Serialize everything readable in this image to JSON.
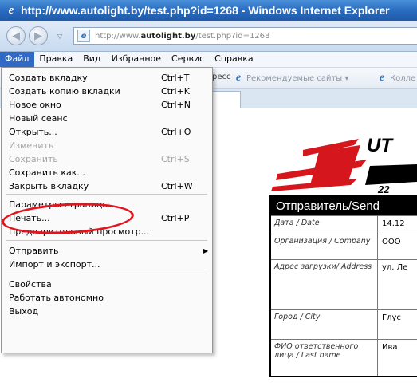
{
  "window": {
    "title": "http://www.autolight.by/test.php?id=1268 - Windows Internet Explorer"
  },
  "address": {
    "prefix": "http://www.",
    "domain": "autolight.by",
    "suffix": "/test.php?id=1268"
  },
  "menubar": [
    "Файл",
    "Правка",
    "Вид",
    "Избранное",
    "Сервис",
    "Справка"
  ],
  "favorites": {
    "partial": "ресс",
    "recommended": "Рекомендуемые сайты ▾",
    "collection": "Колле"
  },
  "file_menu": [
    {
      "label": "Создать вкладку",
      "shortcut": "Ctrl+T"
    },
    {
      "label": "Создать копию вкладки",
      "shortcut": "Ctrl+K"
    },
    {
      "label": "Новое окно",
      "shortcut": "Ctrl+N"
    },
    {
      "label": "Новый сеанс",
      "shortcut": ""
    },
    {
      "label": "Открыть...",
      "shortcut": "Ctrl+O"
    },
    {
      "label": "Изменить",
      "shortcut": "",
      "disabled": true
    },
    {
      "label": "Сохранить",
      "shortcut": "Ctrl+S",
      "disabled": true
    },
    {
      "label": "Сохранить как...",
      "shortcut": ""
    },
    {
      "label": "Закрыть вкладку",
      "shortcut": "Ctrl+W"
    },
    {
      "label": "Параметры страницы...",
      "shortcut": ""
    },
    {
      "label": "Печать...",
      "shortcut": "Ctrl+P"
    },
    {
      "label": "Предварительный просмотр...",
      "shortcut": ""
    },
    {
      "label": "Отправить",
      "shortcut": "",
      "submenu": true
    },
    {
      "label": "Импорт и экспорт...",
      "shortcut": ""
    },
    {
      "label": "Свойства",
      "shortcut": ""
    },
    {
      "label": "Работать автономно",
      "shortcut": ""
    },
    {
      "label": "Выход",
      "shortcut": ""
    }
  ],
  "page": {
    "logo_text": "UT",
    "logo_num": "22",
    "table_header": "Отправитель/Send",
    "rows": [
      {
        "label": "Дата / Date",
        "value": "14.12"
      },
      {
        "label": "Организация / Company",
        "value": "OOO"
      },
      {
        "label": "Адрес загрузки/ Address",
        "value": "ул. Ле"
      },
      {
        "label": "Город / City",
        "value": "Глус"
      },
      {
        "label": "ФИО ответственного лица / Last name",
        "value": "Ива"
      }
    ]
  },
  "colors": {
    "titlebar": "#2a6cc0",
    "menu_highlight": "#316ac5",
    "annotation_circle": "#e3141d",
    "logo_red": "#d6161d"
  }
}
